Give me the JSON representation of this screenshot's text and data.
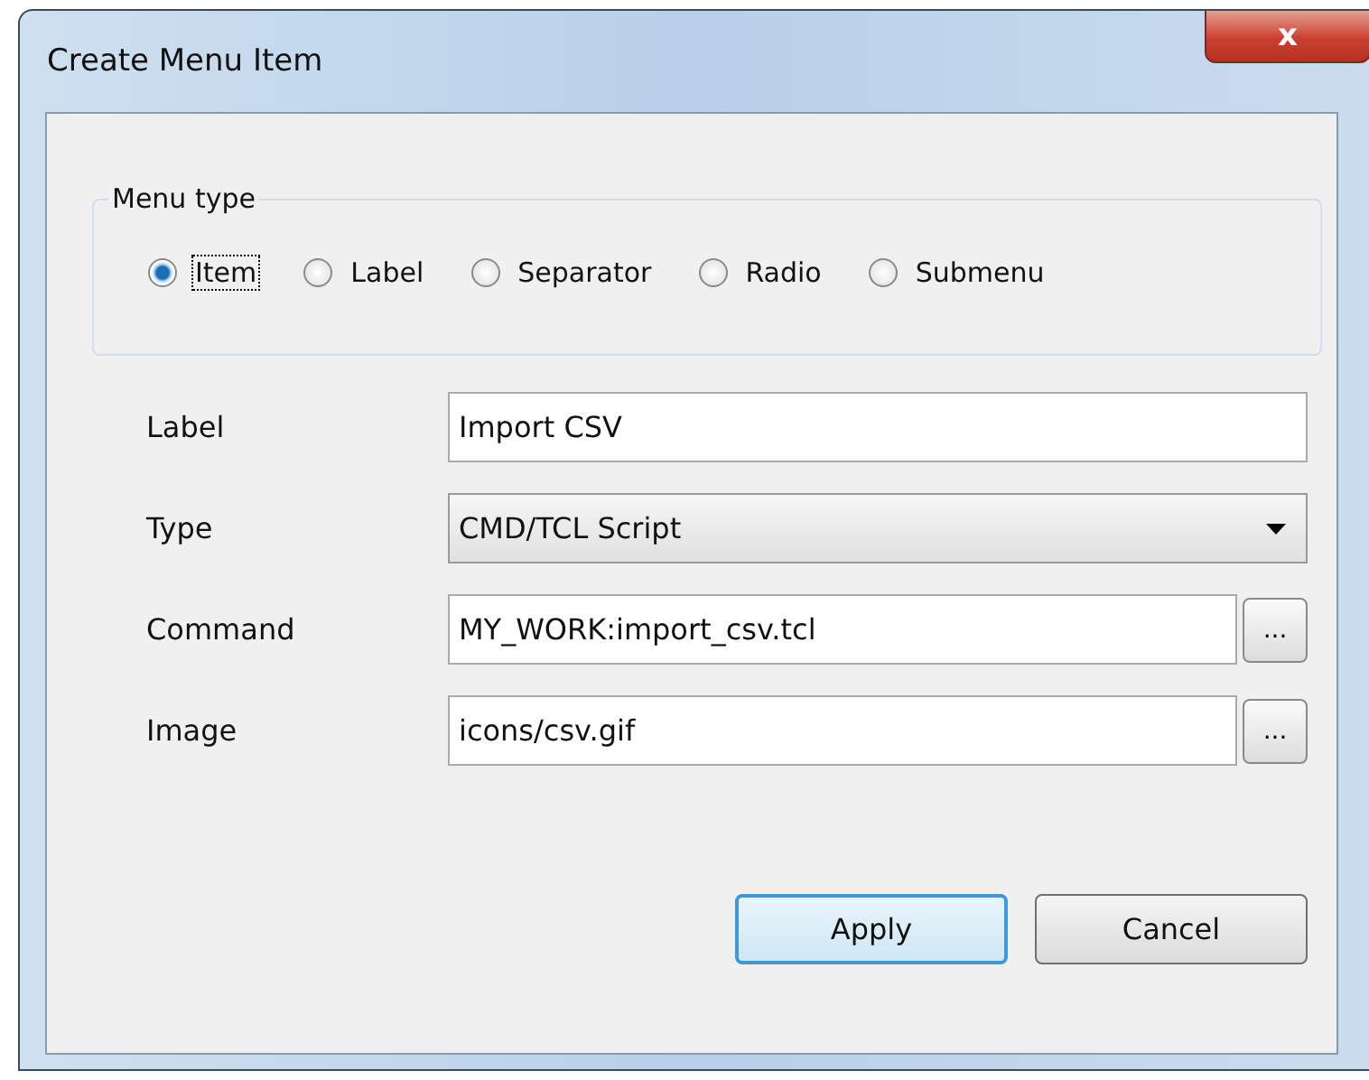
{
  "window": {
    "title": "Create Menu Item",
    "close": "x"
  },
  "menu_type": {
    "legend": "Menu type",
    "options": [
      {
        "label": "Item",
        "selected": true
      },
      {
        "label": "Label",
        "selected": false
      },
      {
        "label": "Separator",
        "selected": false
      },
      {
        "label": "Radio",
        "selected": false
      },
      {
        "label": "Submenu",
        "selected": false
      }
    ]
  },
  "fields": [
    {
      "label": "Label",
      "kind": "text",
      "value": "Import CSV"
    },
    {
      "label": "Type",
      "kind": "dropdown",
      "value": "CMD/TCL Script"
    },
    {
      "label": "Command",
      "kind": "browse",
      "value": "MY_WORK:import_csv.tcl",
      "button": "..."
    },
    {
      "label": "Image",
      "kind": "browse",
      "value": "icons/csv.gif",
      "button": "..."
    }
  ],
  "buttons": [
    {
      "label": "Apply",
      "default": true
    },
    {
      "label": "Cancel",
      "default": false
    }
  ]
}
